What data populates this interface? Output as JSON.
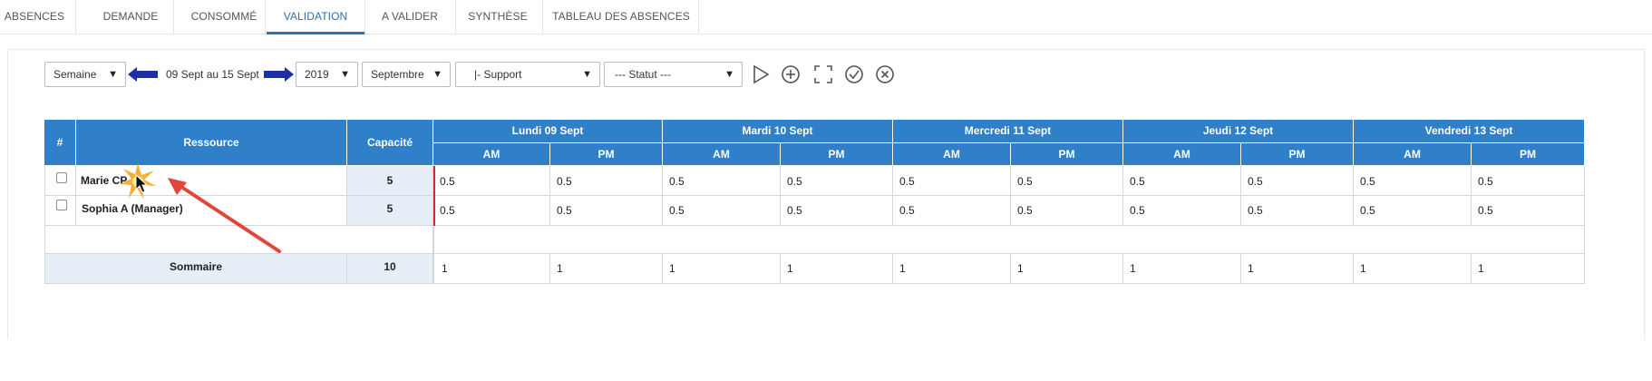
{
  "tabs": [
    {
      "label": "ABSENCES",
      "active": false
    },
    {
      "label": "DEMANDE",
      "active": false
    },
    {
      "label": "CONSOMMÉ",
      "active": false
    },
    {
      "label": "VALIDATION",
      "active": true
    },
    {
      "label": "A VALIDER",
      "active": false
    },
    {
      "label": "SYNTHÈSE",
      "active": false
    },
    {
      "label": "TABLEAU DES ABSENCES",
      "active": false
    }
  ],
  "toolbar": {
    "period_type": "Semaine",
    "period_range": "09 Sept au 15 Sept",
    "year": "2019",
    "month": "Septembre",
    "team": "|- Support",
    "status": "--- Statut ---",
    "caret": "▼",
    "icons": [
      "play-icon",
      "add-circle-icon",
      "fullscreen-icon",
      "check-circle-icon",
      "close-circle-icon"
    ]
  },
  "table": {
    "col_hash": "#",
    "col_resource": "Ressource",
    "col_capacity": "Capacité",
    "days": [
      {
        "label": "Lundi 09 Sept",
        "am": "AM",
        "pm": "PM"
      },
      {
        "label": "Mardi 10 Sept",
        "am": "AM",
        "pm": "PM"
      },
      {
        "label": "Mercredi 11 Sept",
        "am": "AM",
        "pm": "PM"
      },
      {
        "label": "Jeudi 12 Sept",
        "am": "AM",
        "pm": "PM"
      },
      {
        "label": "Vendredi 13 Sept",
        "am": "AM",
        "pm": "PM"
      }
    ],
    "rows": [
      {
        "name": "Marie CP",
        "capacity": "5",
        "values": [
          "0.5",
          "0.5",
          "0.5",
          "0.5",
          "0.5",
          "0.5",
          "0.5",
          "0.5",
          "0.5",
          "0.5"
        ]
      },
      {
        "name": "Sophia A (Manager)",
        "capacity": "5",
        "values": [
          "0.5",
          "0.5",
          "0.5",
          "0.5",
          "0.5",
          "0.5",
          "0.5",
          "0.5",
          "0.5",
          "0.5"
        ]
      }
    ],
    "summary": {
      "label": "Sommaire",
      "capacity": "10",
      "values": [
        "1",
        "1",
        "1",
        "1",
        "1",
        "1",
        "1",
        "1",
        "1",
        "1"
      ]
    }
  },
  "colors": {
    "header_blue": "#2f80c9",
    "active_tab": "#2e6fb5",
    "nav_arrow": "#1c2fa8",
    "annotation_red": "#e0473a",
    "capacity_bg": "#e6eef7"
  }
}
